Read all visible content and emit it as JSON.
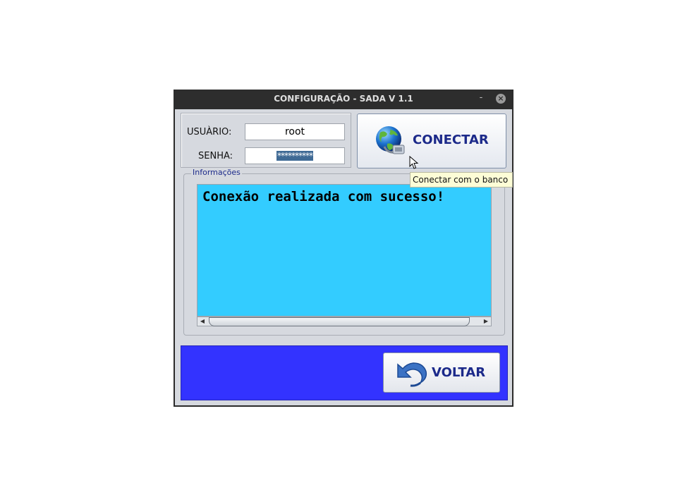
{
  "window": {
    "title": "CONFIGURAÇÃO - SADA V 1.1",
    "minimize_glyph": "-",
    "close_glyph": "×"
  },
  "credentials": {
    "user_label": "USUÀRIO:",
    "user_value": "root",
    "password_label": "SENHA:",
    "password_value": "**********"
  },
  "connect_button": {
    "label": "CONECTAR",
    "icon": "globe-connection-icon",
    "tooltip": "Conectar com o banco"
  },
  "info_group": {
    "title": "Informações",
    "message": "Conexão realizada com sucesso!"
  },
  "back_button": {
    "label": "VOLTAR",
    "icon": "undo-arrow-icon"
  },
  "colors": {
    "info_background": "#33ccff",
    "bottom_panel": "#3333ff",
    "button_text": "#1c2a8a",
    "titlebar": "#2d2d2d"
  }
}
